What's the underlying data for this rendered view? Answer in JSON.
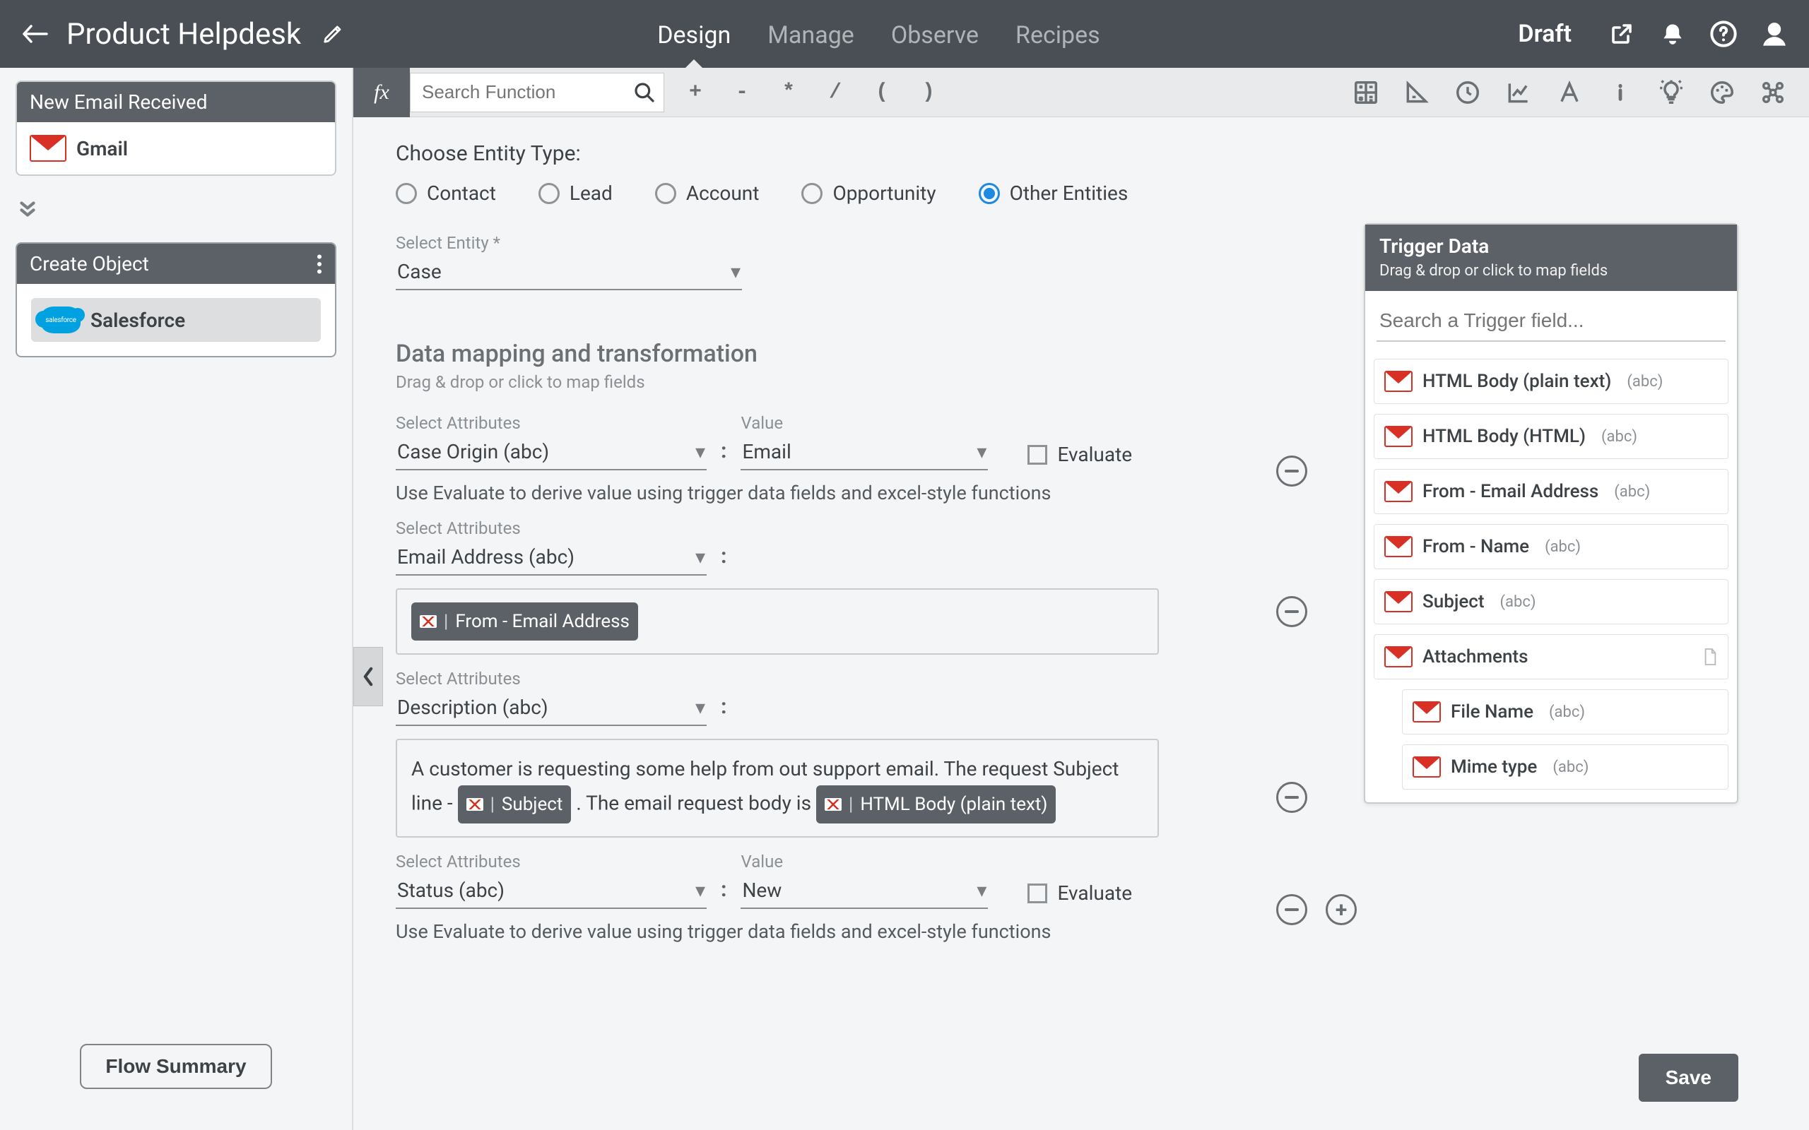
{
  "header": {
    "title": "Product Helpdesk",
    "tabs": [
      "Design",
      "Manage",
      "Observe",
      "Recipes"
    ],
    "active_tab": "Design",
    "status": "Draft"
  },
  "left_panel": {
    "trigger_card": {
      "title": "New Email Received",
      "connector": "Gmail"
    },
    "action_card": {
      "title": "Create Object",
      "connector": "Salesforce"
    },
    "summary_button": "Flow Summary"
  },
  "fx_bar": {
    "fx_label": "fx",
    "search_placeholder": "Search Function",
    "operators": [
      "+",
      "-",
      "*",
      "/",
      "(",
      ")"
    ]
  },
  "entity": {
    "choose_label": "Choose Entity Type:",
    "options": [
      "Contact",
      "Lead",
      "Account",
      "Opportunity",
      "Other Entities"
    ],
    "selected": "Other Entities",
    "select_entity_label": "Select Entity *",
    "select_entity_value": "Case"
  },
  "mapping": {
    "title": "Data mapping and transformation",
    "subtitle": "Drag & drop or click to map fields",
    "attr_label": "Select Attributes",
    "value_label": "Value",
    "evaluate_label": "Evaluate",
    "evaluate_hint": "Use Evaluate to derive value using trigger data fields and excel-style functions",
    "rows": [
      {
        "attribute": "Case Origin (abc)",
        "value": "Email",
        "evaluate": false
      },
      {
        "attribute": "Email Address (abc)",
        "chips": [
          "From - Email Address"
        ]
      },
      {
        "attribute": "Description (abc)",
        "text_parts": {
          "pre": "A customer is requesting some help from out support email. The request Subject line - ",
          "mid": " . The email request body is ",
          "chips": [
            "Subject",
            "HTML Body (plain text)"
          ]
        }
      },
      {
        "attribute": "Status (abc)",
        "value": "New",
        "evaluate": false
      }
    ]
  },
  "trigger_panel": {
    "title": "Trigger Data",
    "subtitle": "Drag & drop or click to map fields",
    "search_placeholder": "Search a Trigger field...",
    "fields": [
      {
        "name": "HTML Body (plain text)",
        "type": "(abc)"
      },
      {
        "name": "HTML Body (HTML)",
        "type": "(abc)"
      },
      {
        "name": "From - Email Address",
        "type": "(abc)"
      },
      {
        "name": "From - Name",
        "type": "(abc)"
      },
      {
        "name": "Subject",
        "type": "(abc)"
      },
      {
        "name": "Attachments",
        "type": "",
        "icon": "file"
      },
      {
        "name": "File Name",
        "type": "(abc)",
        "indent": true
      },
      {
        "name": "Mime type",
        "type": "(abc)",
        "indent": true
      }
    ]
  },
  "save_button": "Save"
}
